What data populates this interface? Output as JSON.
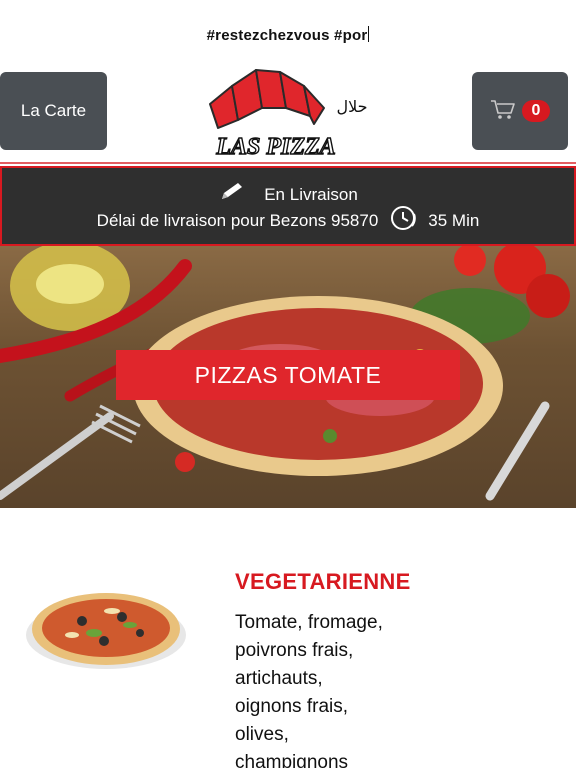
{
  "header": {
    "ticker_text": "#restezchezvous #por",
    "carte_label": "La Carte",
    "logo_text": "LAS PIZZA",
    "halal_text": "حلال",
    "cart_count": "0"
  },
  "delivery": {
    "mode": "En Livraison",
    "delay_label": "Délai de livraison pour Bezons 95870",
    "delay_time": "35 Min"
  },
  "hero": {
    "category": "PIZZAS TOMATE"
  },
  "product": {
    "name": "VEGETARIENNE",
    "description_lines": [
      "Tomate, fromage,",
      "poivrons frais,",
      "artichauts,",
      "oignons frais,",
      "olives,",
      "champignons"
    ]
  },
  "colors": {
    "accent": "#d71920",
    "button_bg": "#4a4f54",
    "banner_bg": "#2f2f2f"
  },
  "icons": {
    "edit": "pencil-icon",
    "clock": "clock-icon",
    "cart": "cart-icon"
  }
}
